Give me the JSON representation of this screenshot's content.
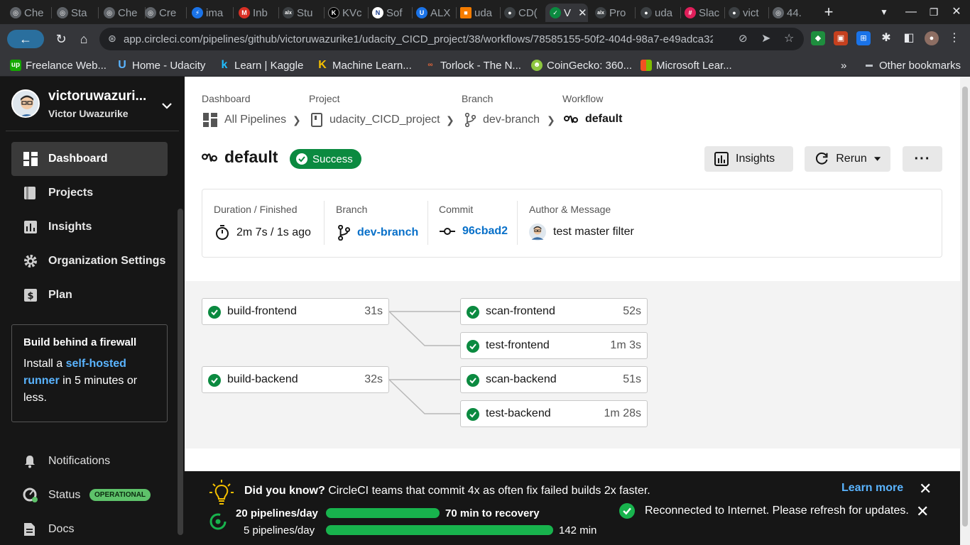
{
  "browser": {
    "tabs": [
      "Che",
      "Sta",
      "Che",
      "Cre",
      "ima",
      "Inb",
      "Stu",
      "KVc",
      "Sof",
      "ALX",
      "uda",
      "CD(",
      "V",
      "Pro",
      "uda",
      "Slac",
      "vict",
      "44."
    ],
    "url": "app.circleci.com/pipelines/github/victoruwazurike1/udacity_CICD_project/38/workflows/78585155-50f2-404d-98a7-e49adca32...",
    "bookmarks": [
      "Freelance Web...",
      "Home - Udacity",
      "Learn | Kaggle",
      "Machine Learn...",
      "Torlock - The N...",
      "CoinGecko: 360...",
      "Microsoft Lear..."
    ],
    "more_bookmarks": "»",
    "other_bookmarks": "Other bookmarks"
  },
  "account": {
    "username": "victoruwazuri...",
    "name": "Victor Uwazurike"
  },
  "sidebar": {
    "nav": [
      {
        "label": "Dashboard"
      },
      {
        "label": "Projects"
      },
      {
        "label": "Insights"
      },
      {
        "label": "Organization Settings"
      },
      {
        "label": "Plan"
      }
    ],
    "promo": {
      "title": "Build behind a firewall",
      "text_before": "Install a ",
      "link": "self-hosted runner",
      "text_after": " in 5 minutes or less."
    },
    "bottom": {
      "notifications": "Notifications",
      "status": "Status",
      "status_badge": "OPERATIONAL",
      "docs": "Docs"
    }
  },
  "breadcrumb": {
    "heads": [
      "Dashboard",
      "Project",
      "Branch",
      "Workflow"
    ],
    "items": [
      "All Pipelines",
      "udacity_CICD_project",
      "dev-branch",
      "default"
    ]
  },
  "workflow": {
    "title": "default",
    "status": "Success",
    "insights_label": "Insights",
    "rerun_label": "Rerun",
    "more_label": "···"
  },
  "info": {
    "duration_head": "Duration / Finished",
    "duration": "2m 7s / 1s ago",
    "branch_head": "Branch",
    "branch": "dev-branch",
    "commit_head": "Commit",
    "commit": "96cbad2",
    "author_head": "Author & Message",
    "message": "test master filter"
  },
  "jobs": [
    {
      "name": "build-frontend",
      "duration": "31s"
    },
    {
      "name": "scan-frontend",
      "duration": "52s"
    },
    {
      "name": "test-frontend",
      "duration": "1m 3s"
    },
    {
      "name": "build-backend",
      "duration": "32s"
    },
    {
      "name": "scan-backend",
      "duration": "51s"
    },
    {
      "name": "test-backend",
      "duration": "1m 28s"
    }
  ],
  "tip": {
    "lead": "Did you know?",
    "text": " CircleCI teams that commit 4x as often fix failed builds 2x faster.",
    "learn_more": "Learn more",
    "rows": [
      {
        "label": "20 pipelines/day",
        "value": "70 min to recovery"
      },
      {
        "label": "5 pipelines/day",
        "value": "142 min"
      }
    ]
  },
  "reconnect": "Reconnected to Internet. Please refresh for updates.",
  "colors": {
    "success": "#0b8a40",
    "link": "#0870c9",
    "sidebar": "#161616",
    "bar": "#18b34d"
  }
}
